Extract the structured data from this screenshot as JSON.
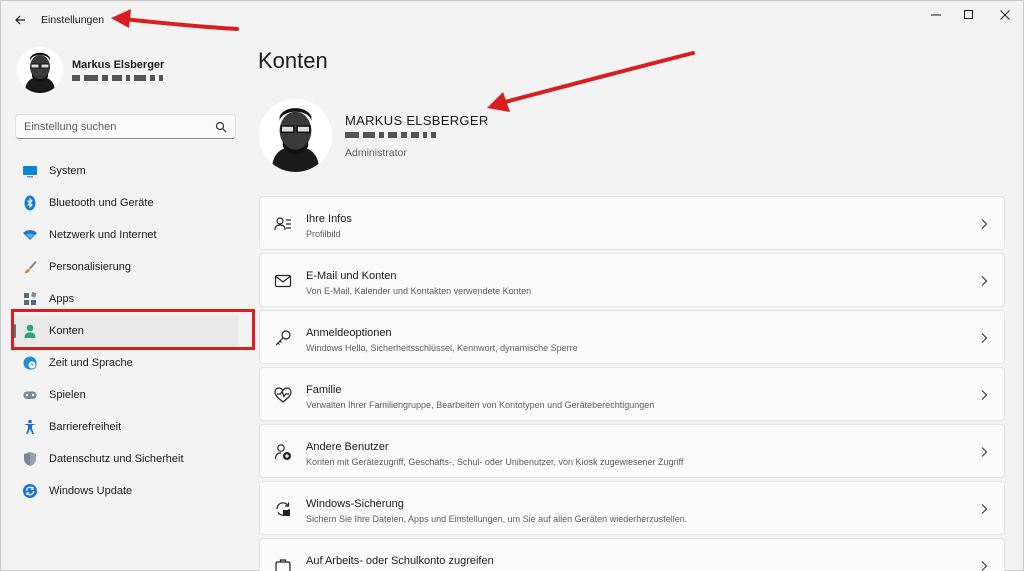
{
  "app": {
    "title": "Einstellungen"
  },
  "window_controls": {
    "minimize_icon": "minimize-icon",
    "maximize_icon": "maximize-icon",
    "close_icon": "close-icon"
  },
  "profile": {
    "name": "Markus Elsberger"
  },
  "search": {
    "placeholder": "Einstellung suchen"
  },
  "sidebar": {
    "items": [
      {
        "label": "System",
        "icon": "system-icon",
        "color": "#0a84d6"
      },
      {
        "label": "Bluetooth und Geräte",
        "icon": "bluetooth-icon",
        "color": "#1a7bd0"
      },
      {
        "label": "Netzwerk und Internet",
        "icon": "wifi-icon",
        "color": "#1d76c9"
      },
      {
        "label": "Personalisierung",
        "icon": "brush-icon",
        "color": "#e0873a"
      },
      {
        "label": "Apps",
        "icon": "apps-icon",
        "color": "#5a6a7a"
      },
      {
        "label": "Konten",
        "icon": "person-icon",
        "color": "#2aa57e",
        "active": true
      },
      {
        "label": "Zeit und Sprache",
        "icon": "clock-globe-icon",
        "color": "#1b8ed6"
      },
      {
        "label": "Spielen",
        "icon": "gamepad-icon",
        "color": "#7b8a99"
      },
      {
        "label": "Barrierefreiheit",
        "icon": "accessibility-icon",
        "color": "#1a6fcf"
      },
      {
        "label": "Datenschutz und Sicherheit",
        "icon": "shield-icon",
        "color": "#7d8793"
      },
      {
        "label": "Windows Update",
        "icon": "update-icon",
        "color": "#1a72d6"
      }
    ]
  },
  "main": {
    "title": "Konten",
    "user": {
      "name": "MARKUS ELSBERGER",
      "role": "Administrator"
    },
    "cards": [
      {
        "title": "Ihre Infos",
        "subtitle": "Profilbild",
        "icon": "person-info-icon"
      },
      {
        "title": "E-Mail und Konten",
        "subtitle": "Von E-Mail, Kalender und Kontakten verwendete Konten",
        "icon": "mail-icon"
      },
      {
        "title": "Anmeldeoptionen",
        "subtitle": "Windows Hello, Sicherheitsschlüssel, Kennwort, dynamische Sperre",
        "icon": "key-icon"
      },
      {
        "title": "Familie",
        "subtitle": "Verwalten Ihrer Familiengruppe, Bearbeiten von Kontotypen und Geräteberechtigungen",
        "icon": "heart-pulse-icon"
      },
      {
        "title": "Andere Benutzer",
        "subtitle": "Konten mit Gerätezugriff, Geschäfts-, Schul- oder Unibenutzer, von Kiosk zugewiesener Zugriff",
        "icon": "add-person-icon"
      },
      {
        "title": "Windows-Sicherung",
        "subtitle": "Sichern Sie Ihre Dateien, Apps und Einstellungen, um Sie auf allen Geräten wiederherzustellen.",
        "icon": "backup-icon"
      },
      {
        "title": "Auf Arbeits- oder Schulkonto zugreifen",
        "subtitle": "",
        "icon": "briefcase-icon"
      }
    ]
  },
  "colors": {
    "annotation_red": "#d81e1e",
    "accent": "#2e8b7a"
  }
}
